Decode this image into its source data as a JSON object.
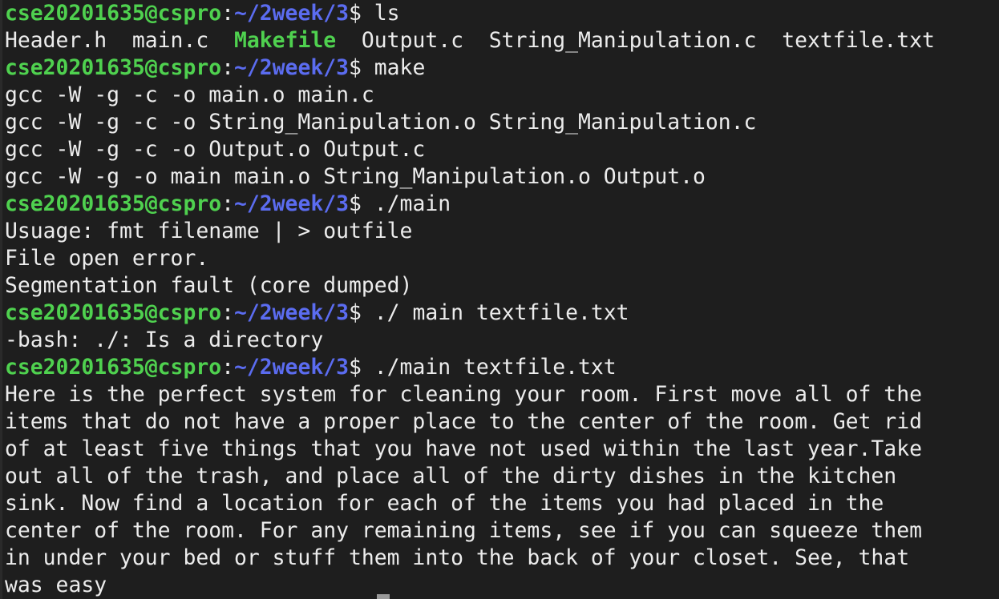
{
  "terminal": {
    "prompt": {
      "user_host": "cse20201635@cspro",
      "separator": ":",
      "path": "~/2week/3",
      "symbol": "$ "
    },
    "blocks": [
      {
        "command": "ls"
      },
      {
        "ls_items": [
          "Header.h",
          "main.c",
          "Makefile",
          "Output.c",
          "String_Manipulation.c",
          "textfile.txt"
        ]
      },
      {
        "command": "make"
      },
      {
        "output": [
          "gcc -W -g -c -o main.o main.c",
          "gcc -W -g -c -o String_Manipulation.o String_Manipulation.c",
          "gcc -W -g -c -o Output.o Output.c",
          "gcc -W -g -o main main.o String_Manipulation.o Output.o"
        ]
      },
      {
        "command": "./main"
      },
      {
        "output": [
          "Usuage: fmt filename | > outfile",
          "File open error.",
          "Segmentation fault (core dumped)"
        ]
      },
      {
        "command": "./ main textfile.txt"
      },
      {
        "output": [
          "-bash: ./: Is a directory"
        ]
      },
      {
        "command": "./main textfile.txt"
      },
      {
        "output": [
          "Here is the perfect system for cleaning your room. First move all of the",
          "items that do not have a proper place to the center of the room. Get rid",
          "of at least five things that you have not used within the last year.Take",
          "out all of the trash, and place all of the dirty dishes in the kitchen",
          "sink. Now find a location for each of the items you had placed in the",
          "center of the room. For any remaining items, see if you can squeeze them",
          "in under your bed or stuff them into the back of your closet. See, that",
          "was easy"
        ]
      }
    ],
    "colors": {
      "background": "#1e1e1e",
      "text": "#ececec",
      "user_host": "#4fd14f",
      "path": "#5b6cf0",
      "executable": "#4fd14f"
    }
  }
}
